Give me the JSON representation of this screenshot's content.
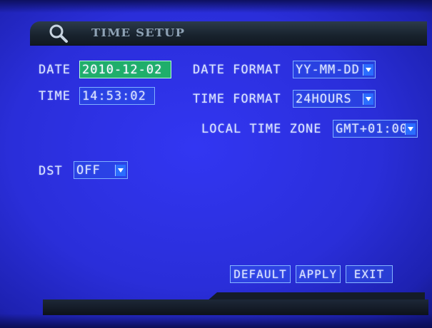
{
  "window": {
    "title": "TIME SETUP",
    "icon": "search-icon"
  },
  "date": {
    "label": "DATE",
    "value": "2010-12-02"
  },
  "time": {
    "label": "TIME",
    "value": "14:53:02"
  },
  "date_format": {
    "label": "DATE FORMAT",
    "value": "YY-MM-DD"
  },
  "time_format": {
    "label": "TIME FORMAT",
    "value": "24HOURS"
  },
  "time_zone": {
    "label": "LOCAL TIME ZONE",
    "value": "GMT+01:00"
  },
  "dst": {
    "label": "DST",
    "value": "OFF"
  },
  "buttons": {
    "default": "DEFAULT",
    "apply": "APPLY",
    "exit": "EXIT"
  },
  "colors": {
    "background": "#2a2ed9",
    "active_field": "#1fae6a",
    "field_border": "#7fb0ff",
    "title_bar": "#18222d"
  }
}
